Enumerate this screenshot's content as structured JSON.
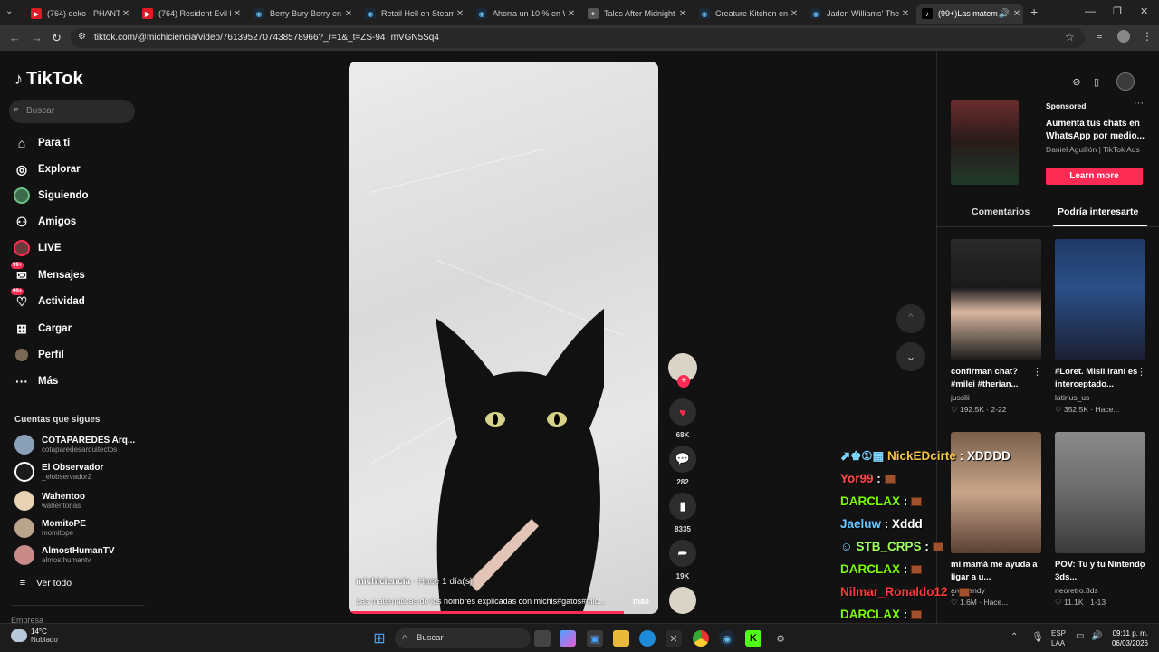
{
  "browser": {
    "tabs": [
      {
        "title": "(764) deko - PHANTA",
        "icon": "youtube-icon"
      },
      {
        "title": "(764) Resident Evil Re",
        "icon": "youtube-icon"
      },
      {
        "title": "Berry Bury Berry en S",
        "icon": "steam-icon"
      },
      {
        "title": "Retail Hell en Steam",
        "icon": "steam-icon"
      },
      {
        "title": "Ahorra un 10 % en W",
        "icon": "steam-icon"
      },
      {
        "title": "Tales After Midnight",
        "icon": "tales-icon"
      },
      {
        "title": "Creature Kitchen en S",
        "icon": "steam-icon"
      },
      {
        "title": "Jaden Williams' The S",
        "icon": "steam-icon"
      },
      {
        "title": "(99+)Las matem",
        "icon": "tiktok-icon"
      }
    ],
    "url": "tiktok.com/@michiciencia/video/7613952707438578966?_r=1&_t=ZS-94TmVGN5Sq4"
  },
  "sidebar": {
    "logo": "TikTok",
    "search_placeholder": "Buscar",
    "nav": [
      {
        "label": "Para ti",
        "icon": "home-icon"
      },
      {
        "label": "Explorar",
        "icon": "compass-icon"
      },
      {
        "label": "Siguiendo",
        "icon": "following-icon"
      },
      {
        "label": "Amigos",
        "icon": "friends-icon"
      },
      {
        "label": "LIVE",
        "icon": "live-icon"
      },
      {
        "label": "Mensajes",
        "icon": "messages-icon",
        "badge": "99+"
      },
      {
        "label": "Actividad",
        "icon": "activity-icon",
        "badge": "99+"
      },
      {
        "label": "Cargar",
        "icon": "upload-icon"
      },
      {
        "label": "Perfil",
        "icon": "profile-icon"
      },
      {
        "label": "Más",
        "icon": "more-icon"
      }
    ],
    "following_title": "Cuentas que sigues",
    "following": [
      {
        "name": "COTAPAREDES Arq...",
        "handle": "cotaparedesarquitectos"
      },
      {
        "name": "El Observador",
        "handle": "_elobservador2"
      },
      {
        "name": "Wahentoo",
        "handle": "wahentorias"
      },
      {
        "name": "MomitoPE",
        "handle": "momitope"
      },
      {
        "name": "AlmostHumanTV",
        "handle": "almosthumantv"
      }
    ],
    "see_all": "Ver todo",
    "footer_cut": "Empresa"
  },
  "video": {
    "author": "michiciencia",
    "time": " · Hace 1 día(s)",
    "description": "Las matematicas de los hombres explicadas con michis#gatos#mic...",
    "more": "más",
    "progress": 0.89
  },
  "actions": {
    "likes": "68K",
    "comments": "282",
    "saves": "8335",
    "shares": "19K"
  },
  "right": {
    "sponsored": "Sponsored",
    "ad_title": "Aumenta tus chats en WhatsApp por medio...",
    "ad_by": "Daniel Aguillón | TikTok Ads",
    "ad_button": "Learn more",
    "tab_comments": "Comentarios",
    "tab_suggest": "Podría interesarte",
    "cards": [
      {
        "title": "confirman chat? #milei #therian...",
        "author": "jusslii",
        "stats": "♡ 192.5K · 2-22"
      },
      {
        "title": "#Loret. Misil iraní es interceptado...",
        "author": "latinus_us",
        "stats": "♡ 352.5K · Hace..."
      },
      {
        "title": "mi mamá me ayuda a ligar a u...",
        "author": "aromandy",
        "stats": "♡ 1.6M · Hace..."
      },
      {
        "title": "POV: Tu y tu Nintendo 3ds...",
        "author": "neoretro.3ds",
        "stats": "♡ 11.1K · 1-13"
      }
    ]
  },
  "chat": [
    {
      "user": "NickEDcirte",
      "msg": "XDDDD",
      "color": "#f5c542",
      "prefix": "⬈♚①▦ "
    },
    {
      "user": "Yor99",
      "msg": "",
      "color": "#ff4d4d",
      "prefix": ""
    },
    {
      "user": "DARCLAX",
      "msg": "",
      "color": "#7CFC00",
      "prefix": ""
    },
    {
      "user": "Jaeluw",
      "msg": "Xddd",
      "color": "#6ec6ff",
      "prefix": ""
    },
    {
      "user": "STB_CRPS",
      "msg": "",
      "color": "#9dff5a",
      "prefix": "☺ "
    },
    {
      "user": "DARCLAX",
      "msg": "",
      "color": "#7CFC00",
      "prefix": ""
    },
    {
      "user": "Nilmar_Ronaldo12",
      "msg": "",
      "color": "#ff3b3b",
      "prefix": ""
    },
    {
      "user": "DARCLAX",
      "msg": "",
      "color": "#7CFC00",
      "prefix": ""
    }
  ],
  "taskbar": {
    "weather_temp": "14°C",
    "weather_desc": "Nublado",
    "search": "Buscar",
    "lang1": "ESP",
    "lang2": "LAA",
    "time": "09:11 p. m.",
    "date": "06/03/2026"
  },
  "colors": {
    "accent": "#fe2c55",
    "bg": "#121212"
  }
}
